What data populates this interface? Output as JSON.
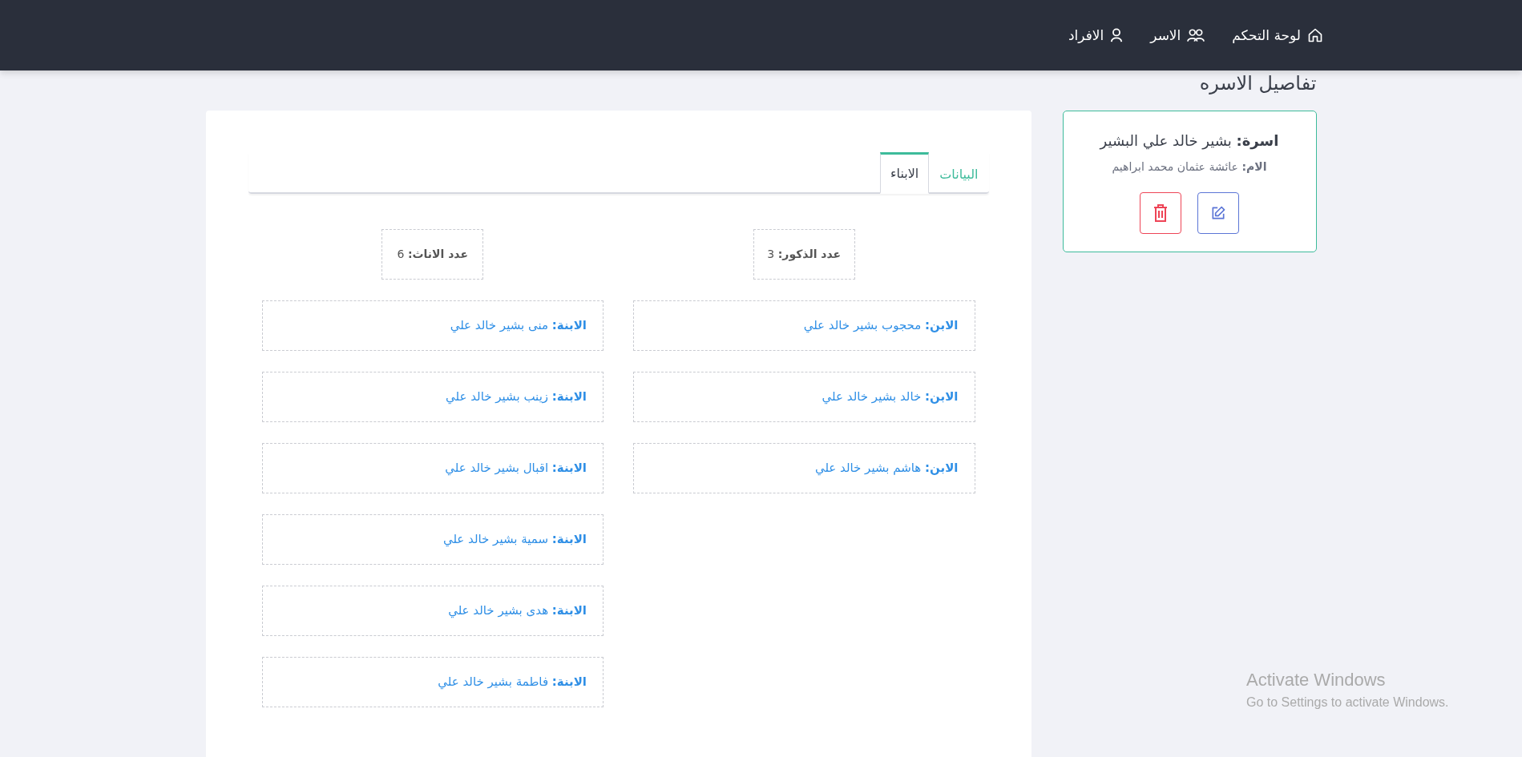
{
  "nav": [
    {
      "label": "لوحة التحكم"
    },
    {
      "label": "الاسر"
    },
    {
      "label": "الافراد"
    }
  ],
  "page_title": "تفاصيل الاسره",
  "family_card": {
    "title": "**اسرة:** بشير خالد علي البشير",
    "mother": "**الام:** عائشة عثمان محمد ابراهيم",
    "actions": [
      {
        "kind": "edit"
      },
      {
        "kind": "delete"
      }
    ]
  },
  "tabs": [
    {
      "label": "البيانات",
      "selected": false
    },
    {
      "label": "الابناء",
      "selected": true
    }
  ],
  "columns": [
    {
      "count": "**عدد الذكور:** 3",
      "children": [
        "**الابن:** محجوب بشير خالد علي",
        "**الابن:** خالد بشير خالد علي",
        "**الابن:** هاشم بشير خالد علي"
      ]
    },
    {
      "count": "**عدد الاناث:** 6",
      "children": [
        "**الابنة:** منى بشير خالد علي",
        "**الابنة:** زينب بشير خالد علي",
        "**الابنة:** اقبال بشير خالد علي",
        "**الابنة:** سمية بشير خالد علي",
        "**الابنة:** هدى بشير خالد علي",
        "**الابنة:** فاطمة بشير خالد علي"
      ]
    }
  ],
  "os_notice": {
    "title": "Activate Windows",
    "text": "Go to Settings to activate Windows."
  }
}
